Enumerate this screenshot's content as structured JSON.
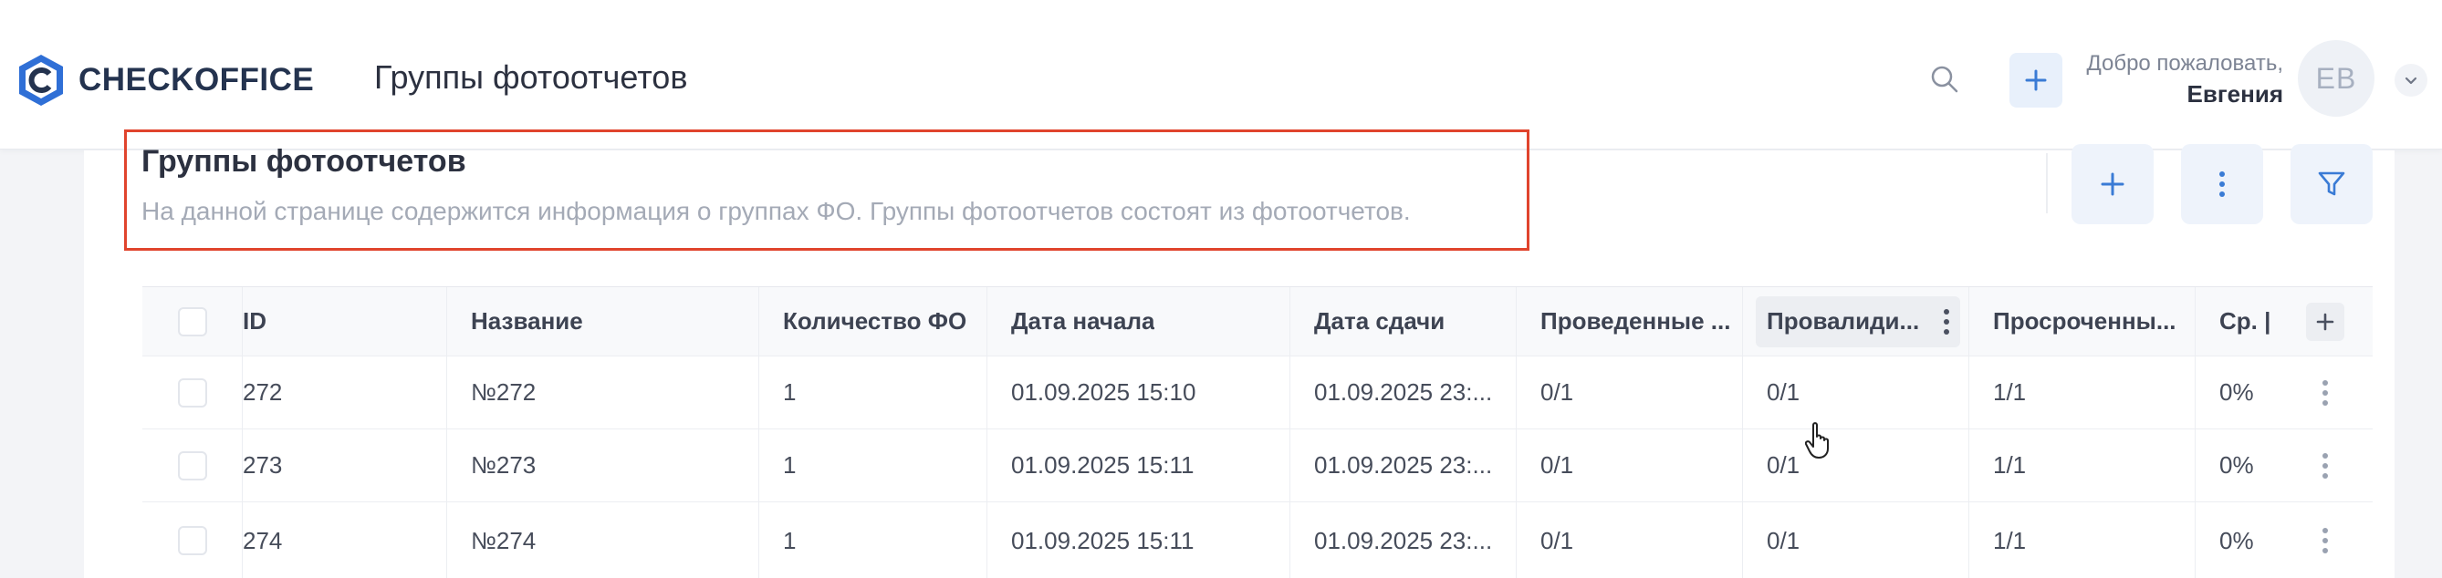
{
  "app": {
    "brand": "CHECKOFFICE",
    "page_title": "Группы фотоотчетов"
  },
  "header": {
    "welcome": "Добро пожаловать,",
    "user_name": "Евгения",
    "avatar_initials": "ЕВ",
    "icons": {
      "search": "search-icon",
      "add": "plus-icon",
      "menu": "chevron-down-icon"
    }
  },
  "page": {
    "heading": "Группы фотоотчетов",
    "description": "На данной странице содержится информация о группах ФО. Группы фотоотчетов состоят из фотоотчетов."
  },
  "toolbar": {
    "icons": [
      "plus-icon",
      "more-vertical-icon",
      "filter-icon"
    ]
  },
  "table": {
    "columns": [
      "ID",
      "Название",
      "Количество ФО",
      "Дата начала",
      "Дата сдачи",
      "Проведенные ...",
      "Провалиди...",
      "Просроченны...",
      "Ср. |"
    ],
    "rows": [
      [
        "272",
        "№272",
        "1",
        "01.09.2025 15:10",
        "01.09.2025 23:...",
        "0/1",
        "0/1",
        "1/1",
        "0%"
      ],
      [
        "273",
        "№273",
        "1",
        "01.09.2025 15:11",
        "01.09.2025 23:...",
        "0/1",
        "0/1",
        "1/1",
        "0%"
      ],
      [
        "274",
        "№274",
        "1",
        "01.09.2025 15:11",
        "01.09.2025 23:...",
        "0/1",
        "0/1",
        "1/1",
        "0%"
      ]
    ]
  },
  "colors": {
    "brand": "#24334f",
    "accent": "#3a7bd5",
    "highlight": "#e0442d"
  }
}
